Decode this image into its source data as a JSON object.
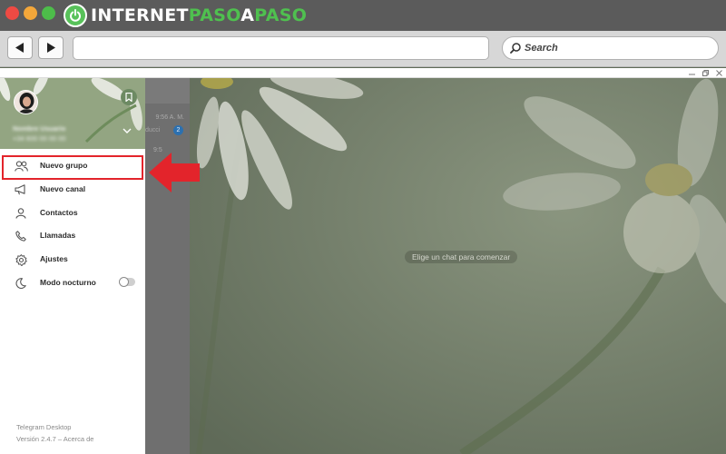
{
  "brand": {
    "part1": "INTERNET",
    "part2": "PASO",
    "part3": "A",
    "part4": "PASO",
    "accent_color": "#4fc04f"
  },
  "browser": {
    "search_label": "Search",
    "back_icon": "back-arrow-icon",
    "forward_icon": "forward-arrow-icon"
  },
  "side_menu": {
    "user": {
      "name": "Nombre Usuario",
      "phone": "+34 600 00 00 00"
    },
    "items": [
      {
        "label": "Nuevo grupo",
        "icon": "group-icon"
      },
      {
        "label": "Nuevo canal",
        "icon": "megaphone-icon"
      },
      {
        "label": "Contactos",
        "icon": "person-icon"
      },
      {
        "label": "Llamadas",
        "icon": "phone-icon"
      },
      {
        "label": "Ajustes",
        "icon": "gear-icon"
      },
      {
        "label": "Modo nocturno",
        "icon": "moon-icon"
      }
    ],
    "night_mode_enabled": false,
    "footer": {
      "app_name": "Telegram Desktop",
      "version": "Versión 2.4.7 – Acerca de"
    },
    "highlight_color": "#e3242b"
  },
  "chat_list": {
    "times": [
      "9:56 A. M.",
      "9:5"
    ],
    "preview": "ducci",
    "badge": "2"
  },
  "chat": {
    "empty_hint": "Elige un chat para comenzar"
  }
}
